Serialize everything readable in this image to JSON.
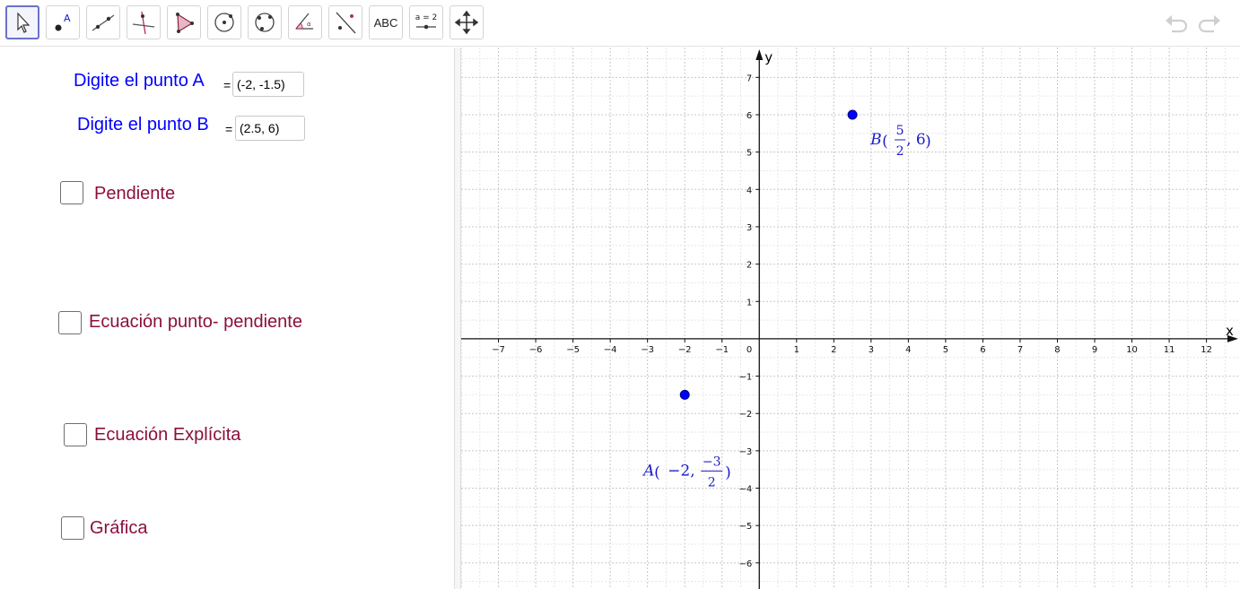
{
  "toolbar": {
    "tools": [
      {
        "name": "move-tool",
        "icon": "pointer-arrow-icon"
      },
      {
        "name": "point-tool",
        "icon": "point-labeled-icon"
      },
      {
        "name": "line-tool",
        "icon": "line-through-two-points-icon"
      },
      {
        "name": "perpendicular-line-tool",
        "icon": "perpendicular-line-icon"
      },
      {
        "name": "polygon-tool",
        "icon": "polygon-icon"
      },
      {
        "name": "circle-center-point-tool",
        "icon": "circle-center-point-icon"
      },
      {
        "name": "circle-three-points-tool",
        "icon": "circle-three-points-icon"
      },
      {
        "name": "angle-tool",
        "icon": "angle-icon"
      },
      {
        "name": "reflect-tool",
        "icon": "reflect-about-line-icon"
      },
      {
        "name": "text-tool",
        "label": "ABC"
      },
      {
        "name": "slider-tool",
        "label": "a = 2"
      },
      {
        "name": "move-graphics-view-tool",
        "icon": "move-view-cross-arrows-icon"
      }
    ],
    "undo_icon": "undo-icon",
    "redo_icon": "redo-icon"
  },
  "algebra": {
    "point_a": {
      "label": "Digite el punto A",
      "equals": "=",
      "value": "(-2, -1.5)"
    },
    "point_b": {
      "label": "Digite el punto B",
      "equals": "=",
      "value": "(2.5, 6)"
    },
    "checkboxes": [
      {
        "label": "Pendiente",
        "checked": false
      },
      {
        "label": "Ecuación punto- pendiente",
        "checked": false
      },
      {
        "label": "Ecuación Explícita",
        "checked": false
      },
      {
        "label": "Gráfica",
        "checked": false
      }
    ]
  },
  "graph": {
    "x_axis_label": "x",
    "y_axis_label": "y",
    "x_range": [
      -8,
      12.9
    ],
    "y_range": [
      -6.7,
      7.8
    ],
    "x_ticks": [
      -7,
      -6,
      -5,
      -4,
      -3,
      -2,
      -1,
      1,
      2,
      3,
      4,
      5,
      6,
      7,
      8,
      9,
      10,
      11,
      12
    ],
    "y_ticks": [
      -6,
      -5,
      -4,
      -3,
      -2,
      -1,
      1,
      2,
      3,
      4,
      5,
      6,
      7
    ],
    "origin_label": "0",
    "grid": true,
    "point_color": "#0000ff",
    "label_color": "#1a1acc",
    "points": [
      {
        "name": "A",
        "x": -2,
        "y": -1.5,
        "coord_1": "−2,",
        "num": "−3",
        "den": "2"
      },
      {
        "name": "B",
        "x": 2.5,
        "y": 6,
        "num": "5",
        "den": "2",
        "coord_2": ", 6"
      }
    ]
  }
}
